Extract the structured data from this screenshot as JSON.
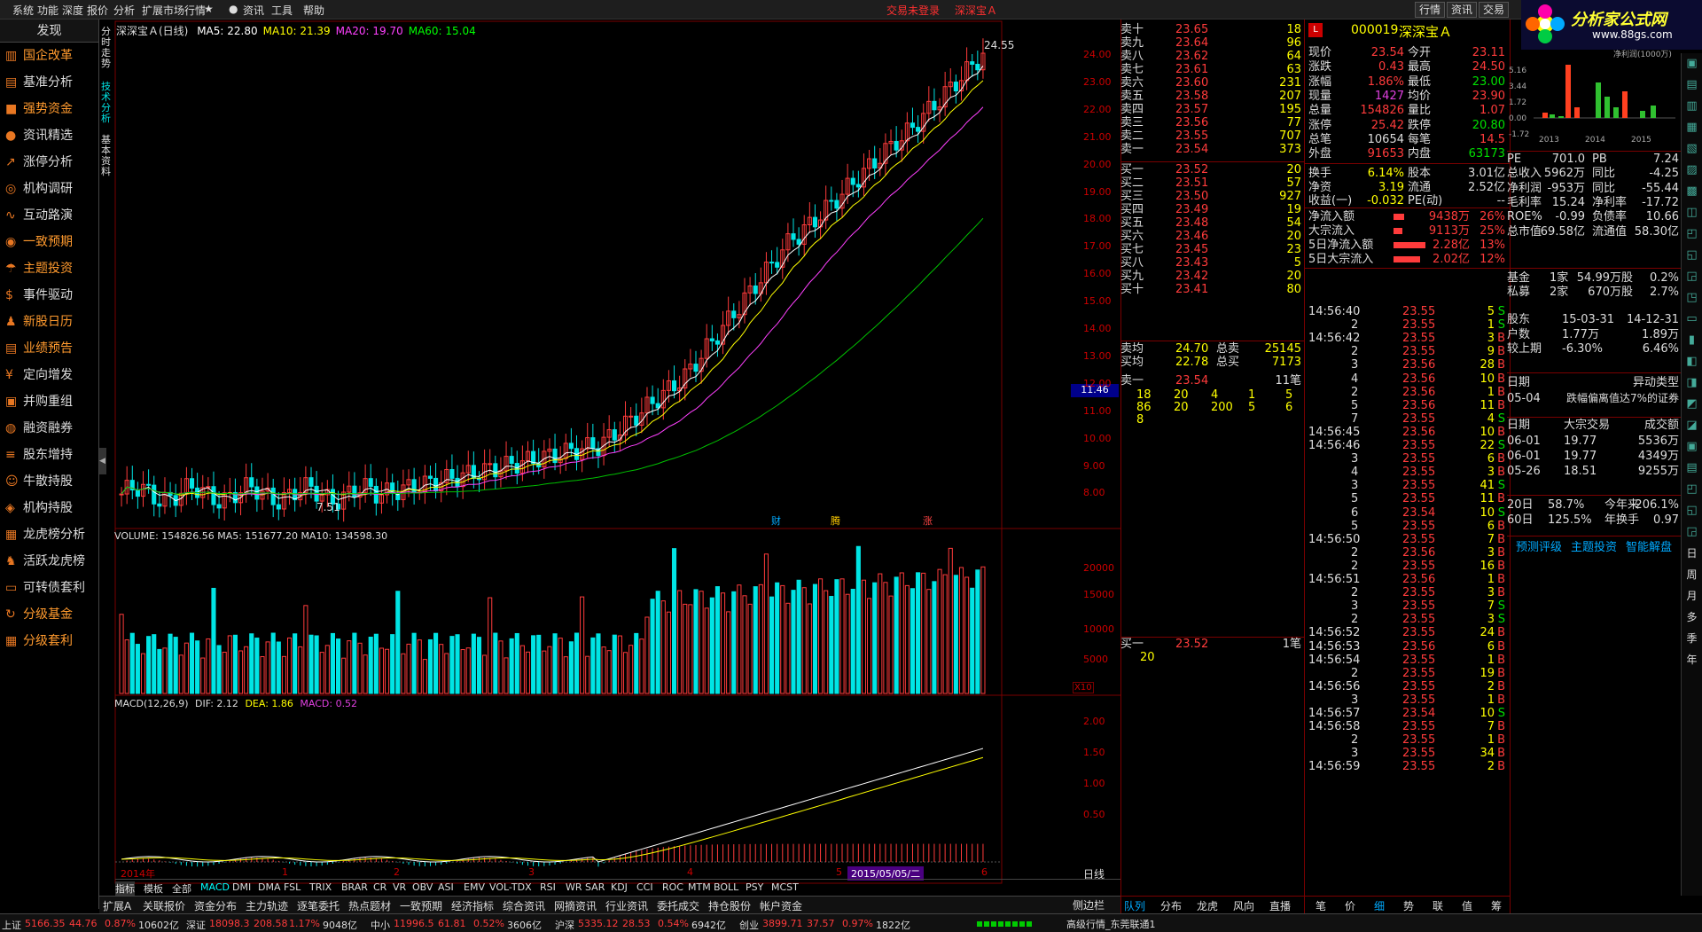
{
  "menu": {
    "items": [
      "系统",
      "功能",
      "深度",
      "报价",
      "分析",
      "扩展市场行情",
      "★",
      "●",
      "资讯",
      "工具",
      "帮助"
    ],
    "status_red": "交易未登录",
    "stock_red": "深深宝Ａ",
    "right_tabs": [
      "行情",
      "资讯",
      "交易"
    ]
  },
  "logo": {
    "text": "分析家公式网",
    "url": "www.88gs.com"
  },
  "sidebar": {
    "title": "发现",
    "items": [
      {
        "label": "国企改革",
        "icon": "building-icon",
        "orange": true
      },
      {
        "label": "基准分析",
        "icon": "bars-icon",
        "orange": false
      },
      {
        "label": "强势资金",
        "icon": "briefcase-icon",
        "orange": true
      },
      {
        "label": "资讯精选",
        "icon": "info-icon",
        "orange": false
      },
      {
        "label": "涨停分析",
        "icon": "trend-up-icon",
        "orange": false
      },
      {
        "label": "机构调研",
        "icon": "search-icon",
        "orange": false
      },
      {
        "label": "互动路演",
        "icon": "line-chart-icon",
        "orange": false
      },
      {
        "label": "一致预期",
        "icon": "target-icon",
        "orange": true
      },
      {
        "label": "主题投资",
        "icon": "umbrella-icon",
        "orange": true
      },
      {
        "label": "事件驱动",
        "icon": "money-bag-icon",
        "orange": false
      },
      {
        "label": "新股日历",
        "icon": "person-icon",
        "orange": true
      },
      {
        "label": "业绩预告",
        "icon": "document-icon",
        "orange": true
      },
      {
        "label": "定向增发",
        "icon": "money-icon",
        "orange": false
      },
      {
        "label": "并购重组",
        "icon": "merge-icon",
        "orange": false
      },
      {
        "label": "融资融券",
        "icon": "coins-icon",
        "orange": false
      },
      {
        "label": "股东增持",
        "icon": "list-icon",
        "orange": false
      },
      {
        "label": "牛散持股",
        "icon": "user-icon",
        "orange": false
      },
      {
        "label": "机构持股",
        "icon": "shield-icon",
        "orange": false
      },
      {
        "label": "龙虎榜分析",
        "icon": "chart-icon",
        "orange": false
      },
      {
        "label": "活跃龙虎榜",
        "icon": "users-icon",
        "orange": false
      },
      {
        "label": "可转债套利",
        "icon": "card-icon",
        "orange": false
      },
      {
        "label": "分级基金",
        "icon": "refresh-icon",
        "orange": true
      },
      {
        "label": "分级套利",
        "icon": "grid-icon",
        "orange": true
      }
    ]
  },
  "chart": {
    "left_tabs": [
      "分时走势",
      "技术分析",
      "基本资料"
    ],
    "title": "深深宝Ａ(日线)",
    "ma": [
      {
        "label": "MA5: 22.80",
        "color": "#ffffff"
      },
      {
        "label": "MA10: 21.39",
        "color": "#ffff00"
      },
      {
        "label": "MA20: 19.70",
        "color": "#ff40ff"
      },
      {
        "label": "MA60: 15.04",
        "color": "#00ff00"
      }
    ],
    "high_label": "24.55",
    "low_label": "7.51",
    "price_ticks": [
      "24.00",
      "23.00",
      "22.00",
      "21.00",
      "20.00",
      "19.00",
      "18.00",
      "17.00",
      "16.00",
      "15.00",
      "14.00",
      "13.00",
      "12.00",
      "11.00",
      "10.00",
      "9.00",
      "8.00"
    ],
    "current_tag": "11.46",
    "markers": [
      "财",
      "腾",
      "涨"
    ],
    "volume_label": "VOLUME: 154826.56  MA5: 151677.20  MA10: 134598.30",
    "vol_ticks": [
      "20000",
      "15000",
      "10000",
      "5000"
    ],
    "vol_unit": "X10",
    "macd_label": "MACD(12,26,9)",
    "dif": "DIF: 2.12",
    "dea": "DEA: 1.86",
    "macd_val": "MACD: 0.52",
    "macd_ticks": [
      "2.00",
      "1.50",
      "1.00",
      "0.50"
    ],
    "x_labels": [
      "2014年",
      "1",
      "2",
      "3",
      "4",
      "5",
      "6"
    ],
    "date_tag": "2015/05/05/二",
    "period": "日线"
  },
  "chart_data": {
    "type": "candlestick",
    "price_range": [
      7.51,
      24.55
    ],
    "volume_max": 20000,
    "macd_range": [
      -0.2,
      2.2
    ]
  },
  "indicator_tabs": [
    "指标",
    "模板",
    "全部",
    "MACD",
    "DMI",
    "DMA",
    "FSL",
    "TRIX",
    "BRAR",
    "CR",
    "VR",
    "OBV",
    "ASI",
    "EMV",
    "VOL-TDX",
    "RSI",
    "WR",
    "SAR",
    "KDJ",
    "CCI",
    "ROC",
    "MTM",
    "BOLL",
    "PSY",
    "MCST"
  ],
  "bottom_tabs": [
    "扩展A",
    "关联报价",
    "资金分布",
    "主力轨迹",
    "逐笔委托",
    "热点题材",
    "一致预期",
    "经济指标",
    "综合资讯",
    "网摘资讯",
    "行业资讯",
    "委托成交",
    "持仓股份",
    "帐户资金"
  ],
  "order_book": {
    "sells": [
      [
        "卖十",
        "23.65",
        "18"
      ],
      [
        "卖九",
        "23.64",
        "96"
      ],
      [
        "卖八",
        "23.62",
        "64"
      ],
      [
        "卖七",
        "23.61",
        "63"
      ],
      [
        "卖六",
        "23.60",
        "231"
      ],
      [
        "卖五",
        "23.58",
        "207"
      ],
      [
        "卖四",
        "23.57",
        "195"
      ],
      [
        "卖三",
        "23.56",
        "77"
      ],
      [
        "卖二",
        "23.55",
        "707"
      ],
      [
        "卖一",
        "23.54",
        "373"
      ]
    ],
    "buys": [
      [
        "买一",
        "23.52",
        "20"
      ],
      [
        "买二",
        "23.51",
        "57"
      ],
      [
        "买三",
        "23.50",
        "927"
      ],
      [
        "买四",
        "23.49",
        "19"
      ],
      [
        "买五",
        "23.48",
        "54"
      ],
      [
        "买六",
        "23.46",
        "20"
      ],
      [
        "买七",
        "23.45",
        "23"
      ],
      [
        "买八",
        "23.43",
        "5"
      ],
      [
        "买九",
        "23.42",
        "20"
      ],
      [
        "买十",
        "23.41",
        "80"
      ]
    ],
    "avg": [
      [
        "卖均",
        "24.70",
        "总卖",
        "25145"
      ],
      [
        "买均",
        "22.78",
        "总买",
        "7173"
      ]
    ],
    "queue_head": [
      "卖一",
      "23.54",
      "11笔"
    ],
    "queue_rows": [
      [
        "18",
        "20",
        "4",
        "1",
        "5"
      ],
      [
        "86",
        "20",
        "200",
        "5",
        "6"
      ],
      [
        "8",
        "",
        "",
        "",
        ""
      ]
    ],
    "buy_head": [
      "买一",
      "23.52",
      "1笔"
    ],
    "buy_queue": "20",
    "tabs": [
      "队列",
      "分布",
      "龙虎",
      "风向",
      "直播"
    ]
  },
  "quote": {
    "code": "000019",
    "name": "深深宝Ａ",
    "rows": [
      [
        "现价",
        "23.54",
        "今开",
        "23.11"
      ],
      [
        "涨跌",
        "0.43",
        "最高",
        "24.50"
      ],
      [
        "涨幅",
        "1.86%",
        "最低",
        "23.00"
      ],
      [
        "现量",
        "1427",
        "均价",
        "23.90"
      ],
      [
        "总量",
        "154826",
        "量比",
        "1.07"
      ],
      [
        "涨停",
        "25.42",
        "跌停",
        "20.80"
      ],
      [
        "总笔",
        "10654",
        "每笔",
        "14.5"
      ],
      [
        "外盘",
        "91653",
        "内盘",
        "63173"
      ]
    ],
    "fund": [
      [
        "换手",
        "6.14%",
        "股本",
        "3.01亿"
      ],
      [
        "净资",
        "3.19",
        "流通",
        "2.52亿"
      ],
      [
        "收益(一)",
        "-0.032",
        "PE(动)",
        "--"
      ]
    ],
    "flows": [
      [
        "净流入额",
        "9438万",
        "26%"
      ],
      [
        "大宗流入",
        "9113万",
        "25%"
      ],
      [
        "5日净流入额",
        "2.28亿",
        "13%"
      ],
      [
        "5日大宗流入",
        "2.02亿",
        "12%"
      ]
    ]
  },
  "ticks": [
    [
      "14:56:40",
      "23.55",
      "5",
      "S"
    ],
    [
      "2",
      "23.55",
      "1",
      "S"
    ],
    [
      "14:56:42",
      "23.55",
      "3",
      "B"
    ],
    [
      "2",
      "23.55",
      "9",
      "B"
    ],
    [
      "3",
      "23.56",
      "28",
      "B"
    ],
    [
      "4",
      "23.56",
      "10",
      "B"
    ],
    [
      "2",
      "23.56",
      "1",
      "B"
    ],
    [
      "5",
      "23.56",
      "11",
      "B"
    ],
    [
      "7",
      "23.55",
      "4",
      "S"
    ],
    [
      "14:56:45",
      "23.56",
      "10",
      "B"
    ],
    [
      "14:56:46",
      "23.55",
      "22",
      "S"
    ],
    [
      "3",
      "23.55",
      "6",
      "B"
    ],
    [
      "4",
      "23.55",
      "3",
      "B"
    ],
    [
      "3",
      "23.55",
      "41",
      "S"
    ],
    [
      "5",
      "23.55",
      "11",
      "B"
    ],
    [
      "6",
      "23.54",
      "10",
      "S"
    ],
    [
      "5",
      "23.55",
      "6",
      "B"
    ],
    [
      "14:56:50",
      "23.55",
      "7",
      "B"
    ],
    [
      "2",
      "23.56",
      "3",
      "B"
    ],
    [
      "2",
      "23.55",
      "16",
      "B"
    ],
    [
      "14:56:51",
      "23.56",
      "1",
      "B"
    ],
    [
      "2",
      "23.55",
      "3",
      "B"
    ],
    [
      "3",
      "23.55",
      "7",
      "S"
    ],
    [
      "2",
      "23.55",
      "3",
      "S"
    ],
    [
      "14:56:52",
      "23.55",
      "24",
      "B"
    ],
    [
      "14:56:53",
      "23.56",
      "6",
      "B"
    ],
    [
      "14:56:54",
      "23.55",
      "1",
      "B"
    ],
    [
      "2",
      "23.55",
      "19",
      "B"
    ],
    [
      "14:56:56",
      "23.55",
      "2",
      "B"
    ],
    [
      "3",
      "23.55",
      "1",
      "B"
    ],
    [
      "14:56:57",
      "23.54",
      "10",
      "S"
    ],
    [
      "14:56:58",
      "23.55",
      "7",
      "B"
    ],
    [
      "2",
      "23.55",
      "1",
      "B"
    ],
    [
      "3",
      "23.55",
      "34",
      "B"
    ],
    [
      "14:56:59",
      "23.55",
      "2",
      "B"
    ]
  ],
  "tick_tabs": [
    "笔",
    "价",
    "细",
    "势",
    "联",
    "值",
    "筹"
  ],
  "f10": {
    "pe_rows": [
      [
        "PE",
        "701.0",
        "PB",
        "7.24"
      ],
      [
        "总收入",
        "5962万",
        "同比",
        "-4.25"
      ],
      [
        "净利润",
        "-953万",
        "同比",
        "-55.44"
      ],
      [
        "毛利率",
        "15.24",
        "净利率",
        "-17.72"
      ],
      [
        "ROE%",
        "-0.99",
        "负债率",
        "10.66"
      ],
      [
        "总市值",
        "69.58亿",
        "流通值",
        "58.30亿"
      ]
    ],
    "hold": [
      [
        "基金",
        "1家",
        "54.99万股",
        "0.2%"
      ],
      [
        "私募",
        "2家",
        "670万股",
        "2.7%"
      ]
    ],
    "holder": [
      [
        "股东",
        "15-03-31",
        "14-12-31"
      ],
      [
        "户数",
        "1.77万",
        "1.89万"
      ],
      [
        "较上期",
        "-6.30%",
        "6.46%"
      ]
    ],
    "unusual_head": [
      "日期",
      "异动类型"
    ],
    "unusual": [
      "05-04",
      "跌幅偏离值达7%的证券"
    ],
    "block_head": [
      "日期",
      "大宗交易",
      "成交额"
    ],
    "block": [
      [
        "06-01",
        "19.77",
        "5536万"
      ],
      [
        "06-01",
        "19.77",
        "4349万"
      ],
      [
        "05-26",
        "18.51",
        "9255万"
      ]
    ],
    "perf": [
      [
        "20日",
        "58.7%",
        "今年来",
        "206.1%"
      ],
      [
        "60日",
        "125.5%",
        "年换手",
        "0.97"
      ]
    ],
    "links": [
      "预测评级",
      "主题投资",
      "智能解盘"
    ],
    "mini_chart": {
      "label": "净利润(1000万)",
      "ticks": [
        "5.16",
        "3.44",
        "1.72",
        "0.00",
        "-1.72"
      ],
      "years": [
        "2013",
        "2014",
        "2015"
      ]
    }
  },
  "right_icons": [
    "日",
    "周",
    "月",
    "多",
    "季",
    "年"
  ],
  "ticker": [
    {
      "name": "上证",
      "val": "5166.35",
      "chg": "44.76",
      "pct": "0.87%",
      "amt": "10602亿"
    },
    {
      "name": "深证",
      "val": "18098.3",
      "chg": "208.58",
      "pct": "1.17%",
      "amt": "9048亿"
    },
    {
      "name": "中小",
      "val": "11996.5",
      "chg": "61.81",
      "pct": "0.52%",
      "amt": "3606亿"
    },
    {
      "name": "沪深",
      "val": "5335.12",
      "chg": "28.53",
      "pct": "0.54%",
      "amt": "6942亿"
    },
    {
      "name": "创业",
      "val": "3899.71",
      "chg": "37.57",
      "pct": "0.97%",
      "amt": "1822亿"
    }
  ],
  "status": "高级行情_东莞联通1",
  "scroll_tabs": [
    "侧边栏"
  ]
}
